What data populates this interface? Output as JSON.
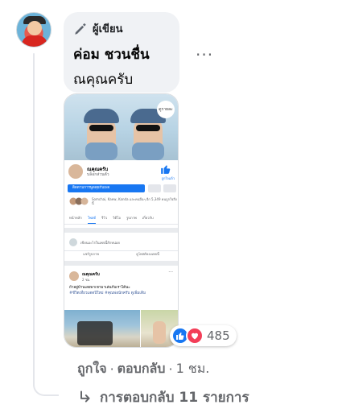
{
  "comment": {
    "badge_label": "ผู้เขียน",
    "badge_icon": "pen-icon",
    "author_name": "ค่อม ชวนชื่น",
    "text": "ณคุณครับ",
    "more_label": "···"
  },
  "attached_screenshot": {
    "badge_text": "ดูรายละ",
    "page_name": "ณคุณครับ",
    "page_sub": "บล็อกส่วนตัว",
    "like_label": "ถูกใจแล้ว",
    "message_button": "ติดตามการพูดคุยกับเพจ",
    "friends_text": "Somchai, Kaew, Kanda และคนอื่นๆ อีก 5,349 คนถูกใจสิ่งนี้",
    "tabs": [
      "หน้าหลัก",
      "โพสต์",
      "รีวิว",
      "วิดีโอ",
      "รูปภาพ",
      "เกี่ยวกับ"
    ],
    "active_tab": "โพสต์",
    "compose_placeholder": "เขียนอะไรในเพจนี้สักหน่อย",
    "compose_actions": [
      "แชร์รูปภาพ",
      "ดูโพสต์ของเพจนี้"
    ],
    "post_name": "ณคุณครับ",
    "post_time": "2 ชม. ·",
    "post_text": "ถ้าอยู่บ้านเลยพาเขามาเล่นกับเราได้นะ",
    "post_tags": "#ชีวิตเที่ยวแดดปีใหม่ #คุณพ่อนักครับ ดูเพิ่มเติม"
  },
  "reactions": {
    "icons": [
      "like-icon",
      "love-icon"
    ],
    "count": "485"
  },
  "actions": {
    "like": "ถูกใจ",
    "separator": "·",
    "reply": "ตอบกลับ",
    "time": "1 ชม."
  },
  "replies": {
    "icon": "reply-arrow-icon",
    "label": "การตอบกลับ 11 รายการ"
  },
  "colors": {
    "bubble_bg": "#f0f2f5",
    "muted_text": "#65676b",
    "like_blue": "#1877f2",
    "love_red": "#f33e58"
  }
}
